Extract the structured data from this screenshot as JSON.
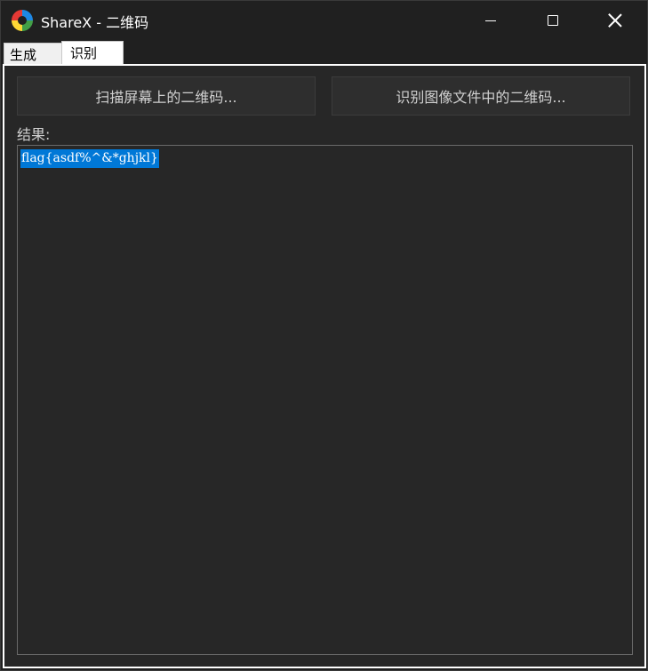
{
  "window": {
    "title": "ShareX - 二维码",
    "icon": "sharex-logo-icon"
  },
  "titlebar_buttons": {
    "minimize": "minimize-icon",
    "maximize": "maximize-icon",
    "close": "close-icon"
  },
  "tabs": [
    {
      "label": "生成",
      "selected": false
    },
    {
      "label": "识别",
      "selected": true
    }
  ],
  "recognize": {
    "scan_screen_button": "扫描屏幕上的二维码...",
    "scan_file_button": "识别图像文件中的二维码...",
    "result_label": "结果:",
    "result_text": "flag{asdf%^&*ghjkl}"
  },
  "colors": {
    "selection": "#0078d7",
    "background": "#272727",
    "titlebar": "#202020"
  }
}
